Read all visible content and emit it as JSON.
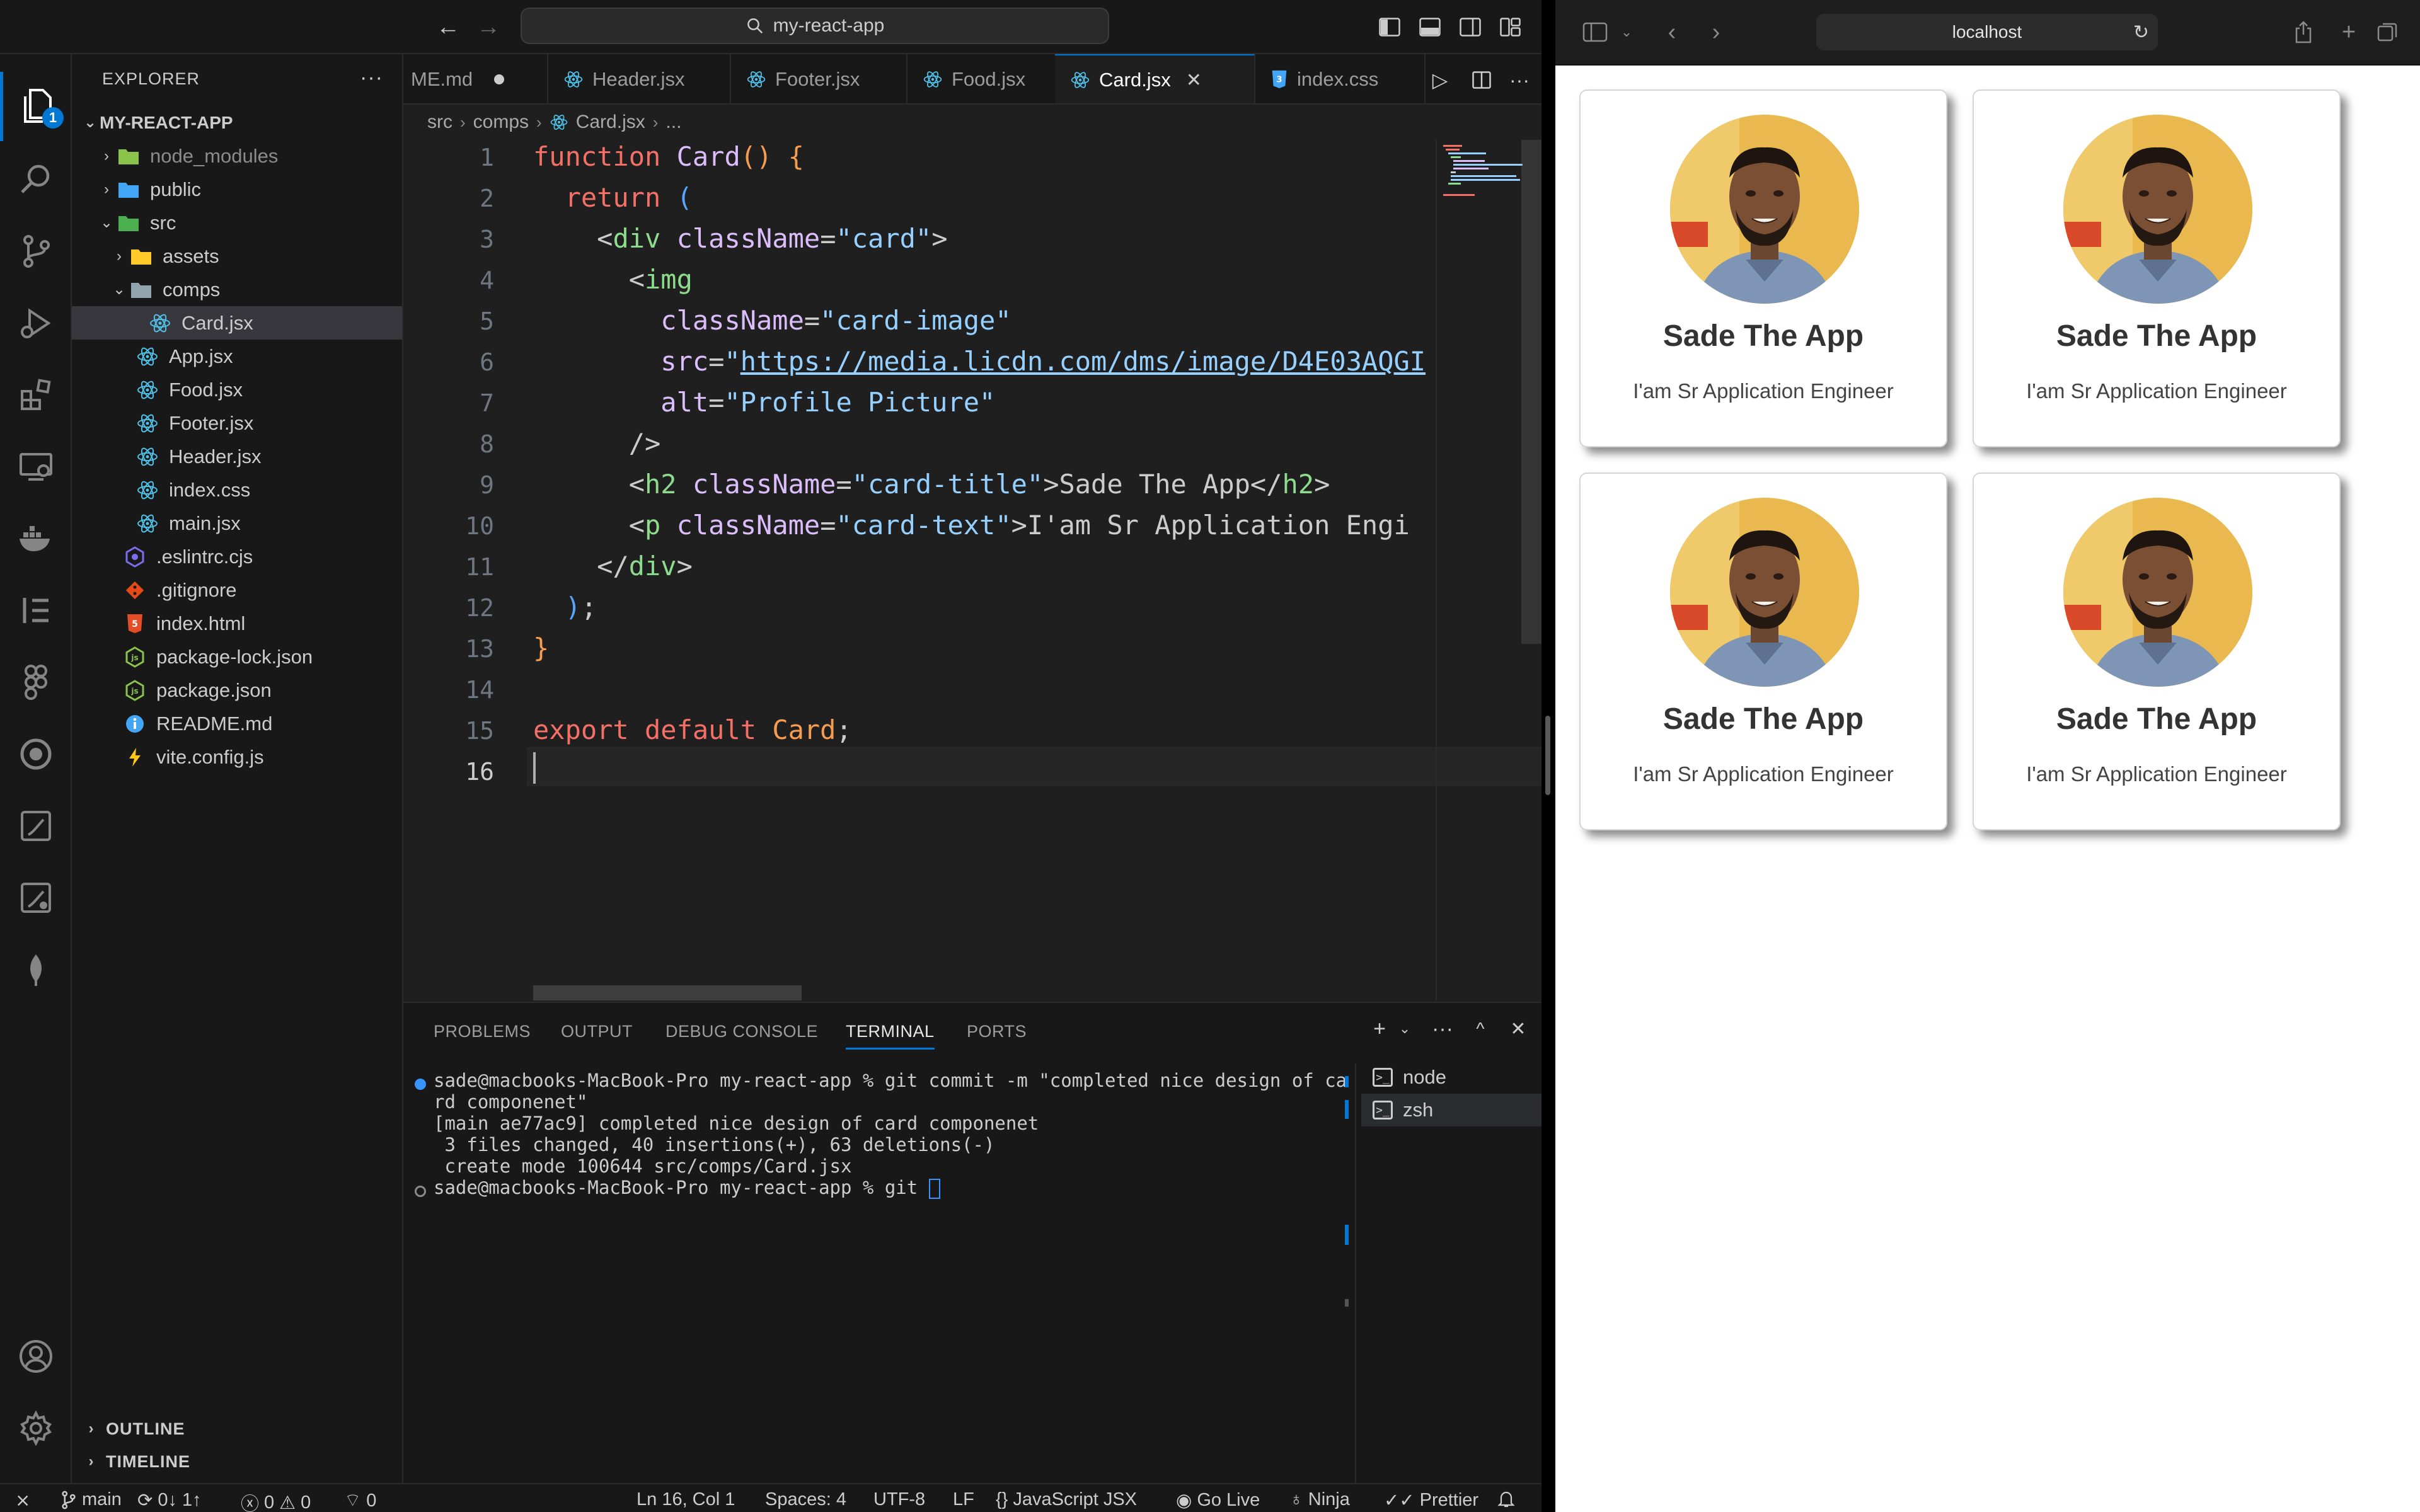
{
  "titlebar": {
    "search_text": "my-react-app"
  },
  "activity": {
    "explorer_badge": "1"
  },
  "sidebar": {
    "title": "EXPLORER",
    "project": "MY-REACT-APP",
    "tree": [
      {
        "label": "node_modules",
        "type": "folder"
      },
      {
        "label": "public",
        "type": "folder"
      },
      {
        "label": "src",
        "type": "folder-open"
      },
      {
        "label": "assets",
        "type": "folder"
      },
      {
        "label": "comps",
        "type": "folder-open"
      },
      {
        "label": "Card.jsx",
        "type": "react"
      },
      {
        "label": "App.jsx",
        "type": "react"
      },
      {
        "label": "Food.jsx",
        "type": "react"
      },
      {
        "label": "Footer.jsx",
        "type": "react"
      },
      {
        "label": "Header.jsx",
        "type": "react"
      },
      {
        "label": "index.css",
        "type": "css"
      },
      {
        "label": "main.jsx",
        "type": "react"
      },
      {
        "label": ".eslintrc.cjs",
        "type": "eslint"
      },
      {
        "label": ".gitignore",
        "type": "git"
      },
      {
        "label": "index.html",
        "type": "html"
      },
      {
        "label": "package-lock.json",
        "type": "node"
      },
      {
        "label": "package.json",
        "type": "node"
      },
      {
        "label": "README.md",
        "type": "info"
      },
      {
        "label": "vite.config.js",
        "type": "vite"
      }
    ],
    "outline": "OUTLINE",
    "timeline": "TIMELINE"
  },
  "tabs": [
    {
      "label": "ME.md"
    },
    {
      "label": "Header.jsx"
    },
    {
      "label": "Footer.jsx"
    },
    {
      "label": "Food.jsx"
    },
    {
      "label": "Card.jsx"
    },
    {
      "label": "index.css"
    }
  ],
  "breadcrumb": {
    "part1": "src",
    "part2": "comps",
    "part3": "Card.jsx",
    "part4": "..."
  },
  "editor": {
    "line_numbers": [
      "1",
      "2",
      "3",
      "4",
      "5",
      "6",
      "7",
      "8",
      "9",
      "10",
      "11",
      "12",
      "13",
      "14",
      "15",
      "16"
    ],
    "code": {
      "l1_kw": "function",
      "l1_fn": "Card",
      "l1_paren": "()",
      "l1_brace": "{",
      "l2_kw": "return",
      "l2_paren": "(",
      "l3_open": "<",
      "l3_tag": "div",
      "l3_attr": "className",
      "l3_eq": "=",
      "l3_str": "\"card\"",
      "l3_close": ">",
      "l4_open": "<",
      "l4_tag": "img",
      "l5_attr": "className",
      "l5_eq": "=",
      "l5_str": "\"card-image\"",
      "l6_attr": "src",
      "l6_eq": "=",
      "l6_q": "\"",
      "l6_url": "https://media.licdn.com/dms/image/D4E03AQGI",
      "l7_attr": "alt",
      "l7_eq": "=",
      "l7_str": "\"Profile Picture\"",
      "l8_close": "/>",
      "l9_open": "<",
      "l9_tag": "h2",
      "l9_attr": "className",
      "l9_eq": "=",
      "l9_str": "\"card-title\"",
      "l9_text": ">Sade The App</",
      "l9_endtag": "h2",
      "l9_gt": ">",
      "l10_open": "<",
      "l10_tag": "p",
      "l10_attr": "className",
      "l10_eq": "=",
      "l10_str": "\"card-text\"",
      "l10_text": ">I'am Sr Application Engi",
      "l11_open": "</",
      "l11_tag": "div",
      "l11_gt": ">",
      "l12_paren": ")",
      "l12_semi": ";",
      "l13_brace": "}",
      "l15_kw1": "export",
      "l15_kw2": "default",
      "l15_name": "Card",
      "l15_semi": ";"
    }
  },
  "panel": {
    "tabs": [
      "PROBLEMS",
      "OUTPUT",
      "DEBUG CONSOLE",
      "TERMINAL",
      "PORTS"
    ],
    "terminal_lines": [
      "sade@macbooks-MacBook-Pro my-react-app % git commit -m \"completed nice design of ca",
      "rd componenet\"",
      "[main ae77ac9] completed nice design of card componenet",
      " 3 files changed, 40 insertions(+), 63 deletions(-)",
      " create mode 100644 src/comps/Card.jsx",
      "sade@macbooks-MacBook-Pro my-react-app % git "
    ],
    "terminals": [
      "node",
      "zsh"
    ]
  },
  "statusbar": {
    "branch": "main",
    "sync": "0↓ 1↑",
    "errors": "0",
    "warnings": "0",
    "ports": "0",
    "position": "Ln 16, Col 1",
    "spaces": "Spaces: 4",
    "encoding": "UTF-8",
    "eol": "LF",
    "language": "JavaScript JSX",
    "golive": "Go Live",
    "ninja": "Ninja",
    "prettier": "Prettier"
  },
  "browser": {
    "url": "localhost",
    "cards": [
      {
        "title": "Sade The App",
        "text": "I'am Sr Application Engineer"
      },
      {
        "title": "Sade The App",
        "text": "I'am Sr Application Engineer"
      },
      {
        "title": "Sade The App",
        "text": "I'am Sr Application Engineer"
      },
      {
        "title": "Sade The App",
        "text": "I'am Sr Application Engineer"
      }
    ]
  },
  "colors": {
    "accent": "#0078d4",
    "editor_bg": "#1f1f1f",
    "sidebar_bg": "#181818",
    "react_icon": "#4fc1e9"
  }
}
